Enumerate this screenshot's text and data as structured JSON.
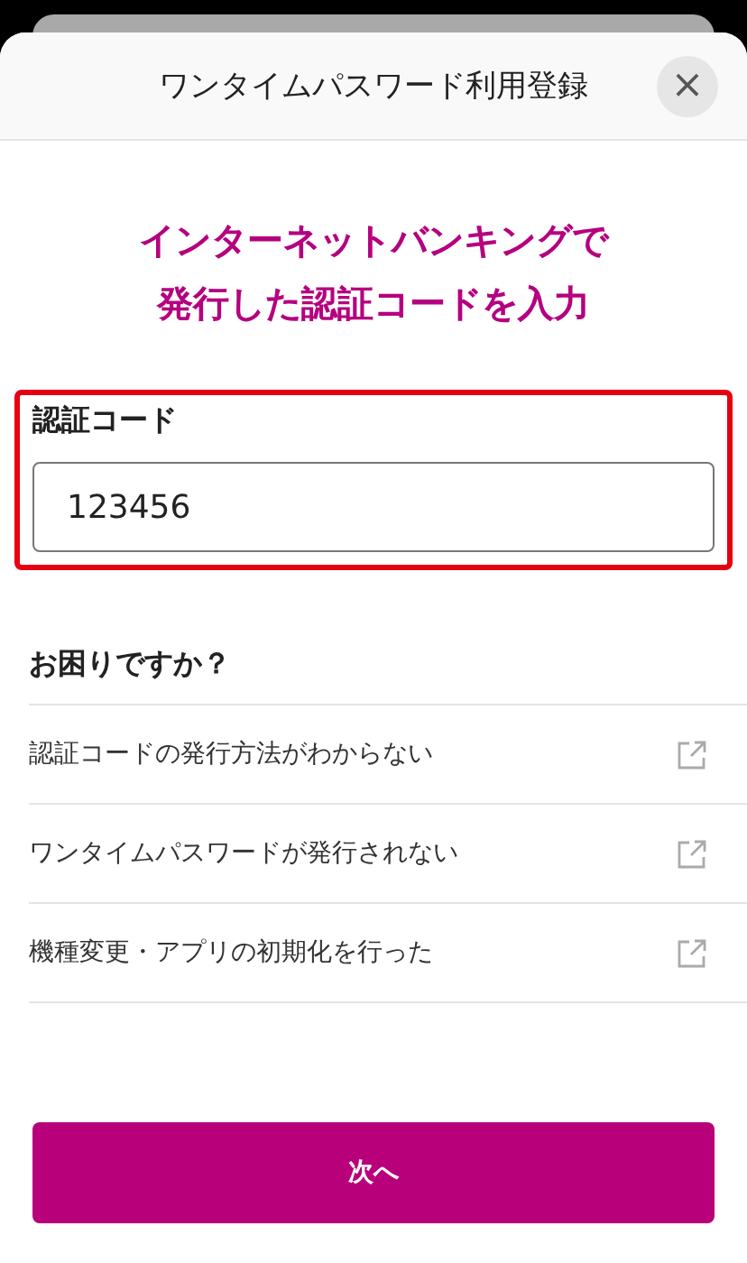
{
  "modal": {
    "title": "ワンタイムパスワード利用登録",
    "close_icon": "×"
  },
  "heading_lines": [
    "インターネットバンキングで",
    "発行した認証コードを入力"
  ],
  "code_field": {
    "label": "認証コード",
    "value": "123456",
    "highlighted": true
  },
  "help": {
    "title": "お困りですか？",
    "links": [
      {
        "label": "認証コードの発行方法がわからない"
      },
      {
        "label": "ワンタイムパスワードが発行されない"
      },
      {
        "label": "機種変更・アプリの初期化を行った"
      }
    ]
  },
  "next_button": "次へ"
}
